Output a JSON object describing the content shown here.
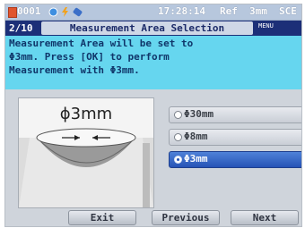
{
  "status": {
    "sample_no": "0001",
    "time": "17:28:14",
    "ref": "Ref",
    "area": "3mm",
    "mode": "SCE"
  },
  "titlebar": {
    "page": "2/10",
    "title": "Measurement Area Selection",
    "menu": "MENU"
  },
  "message": [
    "Measurement Area will be set to",
    "Φ3mm. Press [OK] to perform",
    "Measurement with Φ3mm."
  ],
  "illustration": {
    "label": "ϕ3mm"
  },
  "options": [
    {
      "label": "Φ30mm",
      "selected": false
    },
    {
      "label": "Φ8mm",
      "selected": false
    },
    {
      "label": "Φ3mm",
      "selected": true
    }
  ],
  "buttons": {
    "exit": "Exit",
    "previous": "Previous",
    "next": "Next"
  },
  "colors": {
    "title_bar": "#1c2f78",
    "message_bg": "#66d6ef",
    "selected": "#2653b6"
  }
}
